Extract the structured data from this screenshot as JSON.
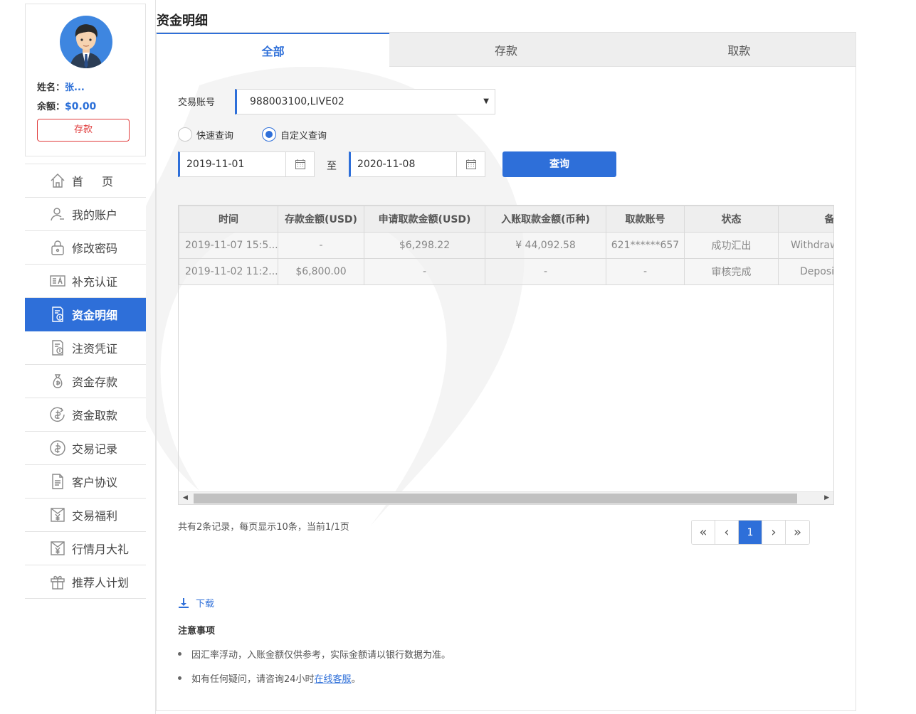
{
  "user": {
    "name_label": "姓名：",
    "name_value": "张...",
    "balance_label": "余额：",
    "balance_value": "$0.00",
    "deposit_button": "存款"
  },
  "sidebar": {
    "items": [
      {
        "label": "首页",
        "icon": "home-icon",
        "active": false
      },
      {
        "label": "我的账户",
        "icon": "user-icon",
        "active": false
      },
      {
        "label": "修改密码",
        "icon": "lock-icon",
        "active": false
      },
      {
        "label": "补充认证",
        "icon": "id-card-icon",
        "active": false
      },
      {
        "label": "资金明细",
        "icon": "statement-icon",
        "active": true
      },
      {
        "label": "注资凭证",
        "icon": "voucher-icon",
        "active": false
      },
      {
        "label": "资金存款",
        "icon": "money-bag-icon",
        "active": false
      },
      {
        "label": "资金取款",
        "icon": "withdraw-coin-icon",
        "active": false
      },
      {
        "label": "交易记录",
        "icon": "dollar-coin-icon",
        "active": false
      },
      {
        "label": "客户协议",
        "icon": "document-icon",
        "active": false
      },
      {
        "label": "交易福利",
        "icon": "yen-envelope-icon",
        "active": false
      },
      {
        "label": "行情月大礼",
        "icon": "yen-envelope-icon",
        "active": false
      },
      {
        "label": "推荐人计划",
        "icon": "gift-icon",
        "active": false
      }
    ]
  },
  "page": {
    "title": "资金明细"
  },
  "tabs": [
    {
      "label": "全部",
      "active": true
    },
    {
      "label": "存款",
      "active": false
    },
    {
      "label": "取款",
      "active": false
    }
  ],
  "filters": {
    "account_label": "交易账号",
    "account_value": "988003100,LIVE02",
    "quick_query": "快速查询",
    "custom_query": "自定义查询",
    "custom_selected": true,
    "start_date": "2019-11-01",
    "to_label": "至",
    "end_date": "2020-11-08",
    "query_button": "查询"
  },
  "table": {
    "headers": [
      "时间",
      "存款金额(USD)",
      "申请取款金额(USD)",
      "入账取款金额(币种)",
      "取款账号",
      "状态",
      "备注"
    ],
    "rows": [
      [
        "2019-11-07 15:5...",
        "-",
        "$6,298.22",
        "¥  44,092.58",
        "621******657",
        "成功汇出",
        "Withdraw"
      ],
      [
        "2019-11-02 11:2...",
        "$6,800.00",
        "-",
        "-",
        "-",
        "审核完成",
        "Deposit"
      ]
    ]
  },
  "pagination": {
    "summary": "共有2条记录，每页显示10条，当前1/1页",
    "first": "«",
    "prev": "‹",
    "current": "1",
    "next": "›",
    "last": "»"
  },
  "download_label": "下载",
  "notes": {
    "title": "注意事项",
    "items": [
      "因汇率浮动，入账金额仅供参考，实际金额请以银行数据为准。",
      "如有任何疑问，请咨询24小时"
    ],
    "link_text": "在线客服",
    "suffix": "。"
  },
  "colors": {
    "accent": "#2e6fd9",
    "danger": "#e03c3c",
    "avatar_bg": "#3e86e0"
  }
}
